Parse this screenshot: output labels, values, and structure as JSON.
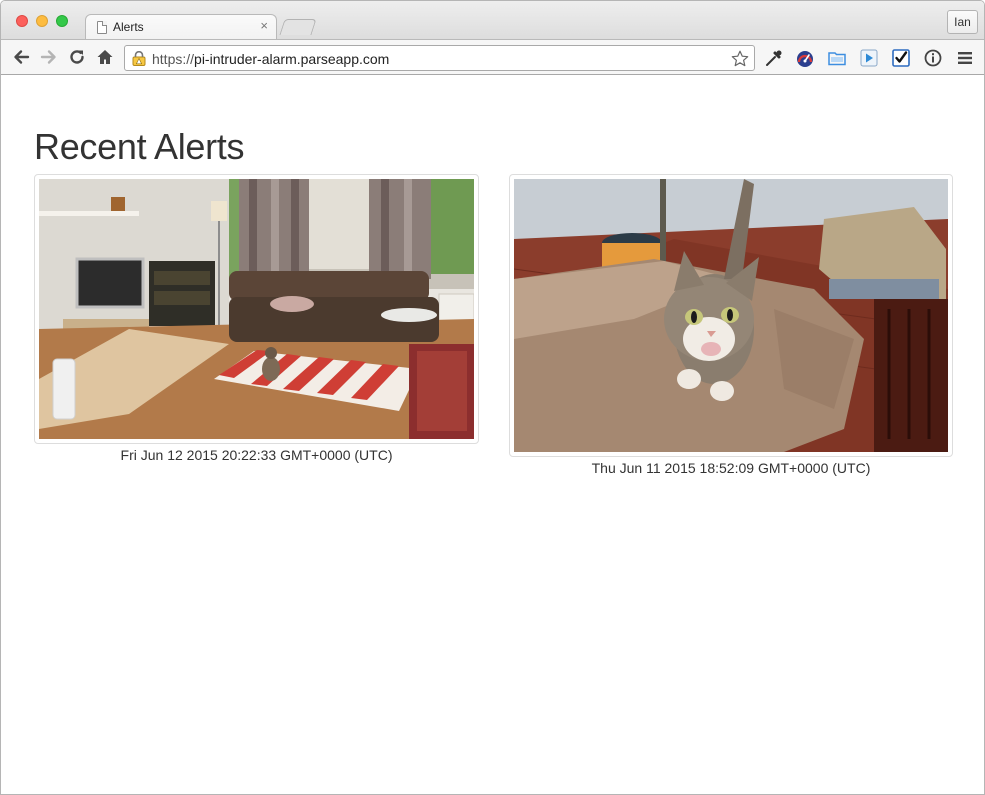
{
  "browser": {
    "tab_title": "Alerts",
    "tab_close": "×",
    "profile": "Ian",
    "url_scheme": "https://",
    "url_host": "pi-intruder-alarm.parseapp.com"
  },
  "page": {
    "heading": "Recent Alerts",
    "alerts": [
      {
        "timestamp": "Fri Jun 12 2015 20:22:33 GMT+0000 (UTC)",
        "image": "living-room-with-cat"
      },
      {
        "timestamp": "Thu Jun 11 2015 18:52:09 GMT+0000 (UTC)",
        "image": "cat-on-armchair"
      }
    ]
  },
  "icons": {
    "back": "back-arrow-icon",
    "forward": "forward-arrow-icon",
    "reload": "reload-icon",
    "home": "home-icon",
    "lock": "lock-warning-icon",
    "bookmark": "star-icon",
    "menu": "hamburger-menu-icon"
  },
  "colors": {
    "heading": "#333333",
    "caption": "#333333",
    "thumb_border": "#dddddd"
  }
}
